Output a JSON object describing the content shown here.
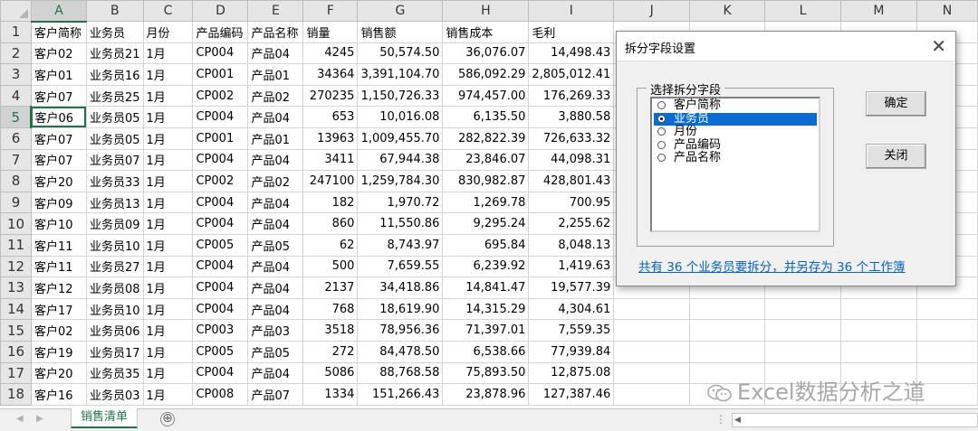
{
  "columns": [
    "A",
    "B",
    "C",
    "D",
    "E",
    "F",
    "G",
    "H",
    "I",
    "J",
    "K",
    "L",
    "M",
    "N"
  ],
  "active_col": "A",
  "active_row": 5,
  "headers": [
    "客户简称",
    "业务员",
    "月份",
    "产品编码",
    "产品名称",
    "销量",
    "销售额",
    "销售成本",
    "毛利"
  ],
  "rows": [
    [
      "客户02",
      "业务员21",
      "1月",
      "CP004",
      "产品04",
      "4245",
      "50,574.50",
      "36,076.07",
      "14,498.43"
    ],
    [
      "客户01",
      "业务员16",
      "1月",
      "CP001",
      "产品01",
      "34364",
      "3,391,104.70",
      "586,092.29",
      "2,805,012.41"
    ],
    [
      "客户07",
      "业务员25",
      "1月",
      "CP002",
      "产品02",
      "270235",
      "1,150,726.33",
      "974,457.00",
      "176,269.33"
    ],
    [
      "客户06",
      "业务员05",
      "1月",
      "CP004",
      "产品04",
      "653",
      "10,016.08",
      "6,135.50",
      "3,880.58"
    ],
    [
      "客户07",
      "业务员05",
      "1月",
      "CP001",
      "产品01",
      "13963",
      "1,009,455.70",
      "282,822.39",
      "726,633.32"
    ],
    [
      "客户07",
      "业务员07",
      "1月",
      "CP004",
      "产品04",
      "3411",
      "67,944.38",
      "23,846.07",
      "44,098.31"
    ],
    [
      "客户20",
      "业务员33",
      "1月",
      "CP002",
      "产品02",
      "247100",
      "1,259,784.30",
      "830,982.87",
      "428,801.43"
    ],
    [
      "客户09",
      "业务员13",
      "1月",
      "CP004",
      "产品04",
      "182",
      "1,970.72",
      "1,269.78",
      "700.95"
    ],
    [
      "客户10",
      "业务员09",
      "1月",
      "CP004",
      "产品04",
      "860",
      "11,550.86",
      "9,295.24",
      "2,255.62"
    ],
    [
      "客户11",
      "业务员10",
      "1月",
      "CP005",
      "产品05",
      "62",
      "8,743.97",
      "695.84",
      "8,048.13"
    ],
    [
      "客户11",
      "业务员27",
      "1月",
      "CP004",
      "产品04",
      "500",
      "7,659.55",
      "6,239.92",
      "1,419.63"
    ],
    [
      "客户12",
      "业务员08",
      "1月",
      "CP004",
      "产品04",
      "2137",
      "34,418.86",
      "14,841.47",
      "19,577.39"
    ],
    [
      "客户17",
      "业务员10",
      "1月",
      "CP004",
      "产品04",
      "768",
      "18,619.90",
      "14,315.29",
      "4,304.61"
    ],
    [
      "客户02",
      "业务员06",
      "1月",
      "CP003",
      "产品03",
      "3518",
      "78,956.36",
      "71,397.01",
      "7,559.35"
    ],
    [
      "客户19",
      "业务员17",
      "1月",
      "CP005",
      "产品05",
      "272",
      "84,478.50",
      "6,538.66",
      "77,939.84"
    ],
    [
      "客户20",
      "业务员35",
      "1月",
      "CP004",
      "产品04",
      "5086",
      "88,768.58",
      "75,893.50",
      "12,875.08"
    ],
    [
      "客户16",
      "业务员03",
      "1月",
      "CP008",
      "产品07",
      "1334",
      "151,266.43",
      "23,878.96",
      "127,387.46"
    ]
  ],
  "sheet_tab": "销售清单",
  "add_sheet": "⊕",
  "dialog": {
    "title": "拆分字段设置",
    "close": "✕",
    "group_label": "选择拆分字段",
    "options": [
      "客户简称",
      "业务员",
      "月份",
      "产品编码",
      "产品名称"
    ],
    "selected_index": 1,
    "ok": "确定",
    "cancel": "关闭",
    "info": "共有 36 个业务员要拆分，并另存为 36 个工作簿"
  },
  "watermark": "Excel数据分析之道",
  "colors": {
    "accent": "#217346",
    "selection": "#0a6bd1",
    "link": "#0563c1"
  }
}
